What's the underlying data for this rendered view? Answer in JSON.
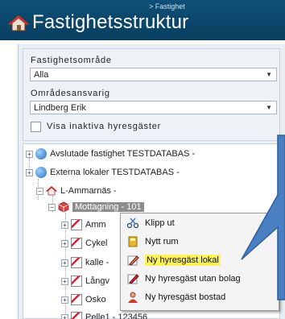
{
  "header": {
    "breadcrumb": "> Fastighet",
    "title": "Fastighetsstruktur"
  },
  "filters": {
    "area_label": "Fastighetsområde",
    "area_value": "Alla",
    "manager_label": "Områdesansvarig",
    "manager_value": "Lindberg Erik",
    "inactive_label": "Visa inaktiva hyresgäster",
    "inactive_checked": false
  },
  "tree": {
    "nodes": [
      {
        "label": "Avslutade fastighet TESTDATABAS -"
      },
      {
        "label": "Externa lokaler TESTDATABAS -"
      },
      {
        "label": "L-Ammarnäs -"
      },
      {
        "label": "Mottagning - 101"
      },
      {
        "label": "Amm"
      },
      {
        "label": "Cykel"
      },
      {
        "label": "kalle -"
      },
      {
        "label": "Långv"
      },
      {
        "label": "Osko"
      },
      {
        "label": "Pelle1 - 123456"
      }
    ]
  },
  "context_menu": {
    "items": [
      {
        "label": "Klipp ut",
        "icon": "scissors-icon"
      },
      {
        "label": "Nytt rum",
        "icon": "new-room-icon"
      },
      {
        "label": "Ny hyresgäst lokal",
        "icon": "pencil-icon"
      },
      {
        "label": "Ny hyresgäst utan bolag",
        "icon": "pencil-icon"
      },
      {
        "label": "Ny hyresgäst bostad",
        "icon": "person-icon"
      }
    ]
  },
  "colors": {
    "header_bg": "#0d4f77",
    "callout_fill": "#4a7fc2",
    "highlight": "#fff25a"
  }
}
